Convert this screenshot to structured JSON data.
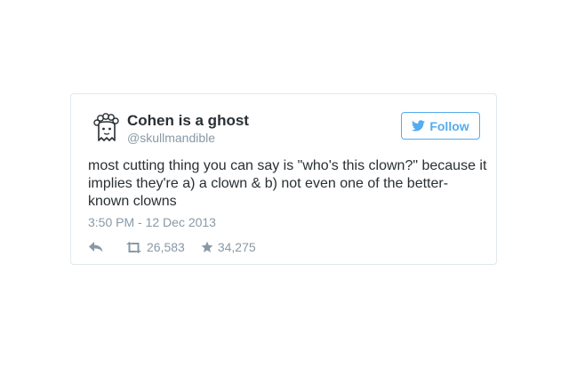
{
  "tweet": {
    "display_name": "Cohen is a ghost",
    "handle": "@skullmandible",
    "follow_label": "Follow",
    "text": "most cutting thing you can say is \"who's this clown?\" because it implies they're a) a clown & b) not even one of the better-known clowns",
    "timestamp": "3:50 PM - 12 Dec 2013",
    "retweets": "26,583",
    "favorites": "34,275"
  },
  "icons": {
    "avatar": "ghost-avatar",
    "follow": "bird-icon",
    "reply": "reply-icon",
    "retweet": "retweet-icon",
    "favorite": "star-icon"
  },
  "colors": {
    "accent": "#55acee",
    "text": "#292f33",
    "muted": "#8899a6",
    "border": "#e1e8ed"
  }
}
